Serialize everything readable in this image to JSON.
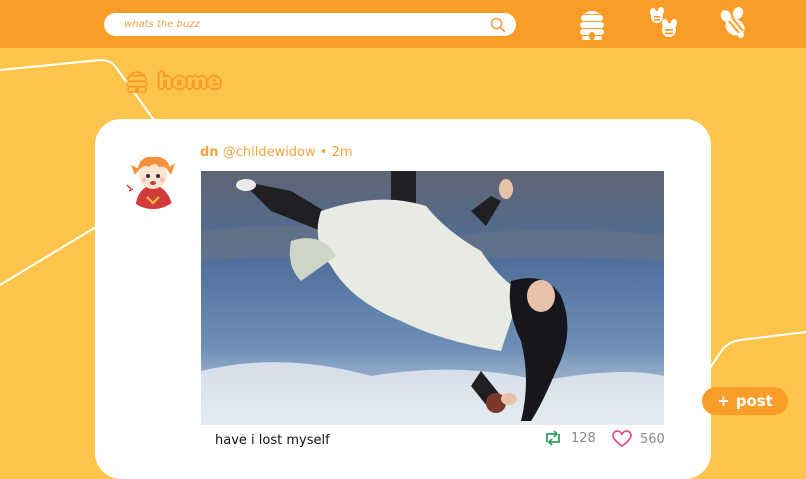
{
  "search": {
    "placeholder": "whats the buzz"
  },
  "nav": {
    "icons": [
      "beehive-icon",
      "bee-notifications-icon",
      "bee-profile-icon"
    ]
  },
  "page": {
    "title": "home"
  },
  "post": {
    "author_name": "dn",
    "handle": "@childewidow",
    "separator": "•",
    "time": "2m",
    "caption": "have i lost myself",
    "reposts": "128",
    "likes": "560"
  },
  "actions": {
    "post_label": "post",
    "post_symbol": "+"
  },
  "colors": {
    "background": "#fcc44a",
    "topbar": "#f99d28",
    "accent": "#f99d28",
    "repost": "#2e9e5e",
    "like": "#e0507a"
  }
}
